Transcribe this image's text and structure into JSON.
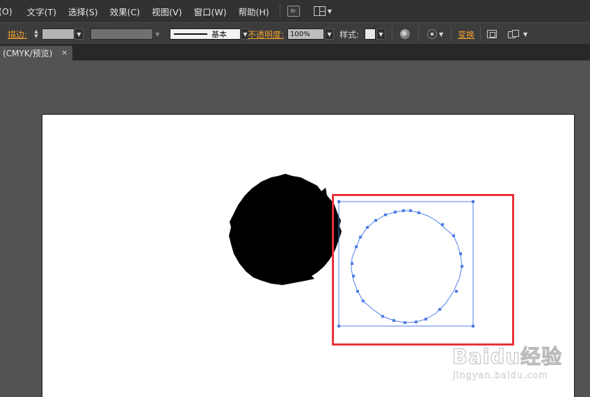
{
  "menubar": {
    "items": [
      {
        "label": "(O)"
      },
      {
        "label": "文字(T)"
      },
      {
        "label": "选择(S)"
      },
      {
        "label": "效果(C)"
      },
      {
        "label": "视图(V)"
      },
      {
        "label": "窗口(W)"
      },
      {
        "label": "帮助(H)"
      }
    ],
    "bridge_label": "Br",
    "bridge_icon": "bridge-icon",
    "layout_icon": "arrange-documents-icon"
  },
  "controlbar": {
    "stroke_label": "描边:",
    "stroke_style_label": "基本",
    "opacity_label": "不透明度:",
    "opacity_value": "100%",
    "style_label": "样式:",
    "transform_label": "变换",
    "icons": [
      "recolor-artwork-icon",
      "align-to-selection-icon",
      "transform-bounds-icon",
      "isolate-group-icon"
    ],
    "colors": {
      "stroke_swatch": "#b4b4b4",
      "brush_field": "#707070",
      "link_label": "#f0a030"
    }
  },
  "tabbar": {
    "document_tab_label": "(CMYK/预览)",
    "close_label": "×"
  },
  "canvas": {
    "artboard_color": "#ffffff",
    "shape_fill": "#000000",
    "selection_color": "#4f7fe8",
    "highlight_box_color": "#e8323c"
  },
  "watermark": {
    "logo_text": "Baidu经验",
    "url": "jingyan.baidu.com"
  }
}
